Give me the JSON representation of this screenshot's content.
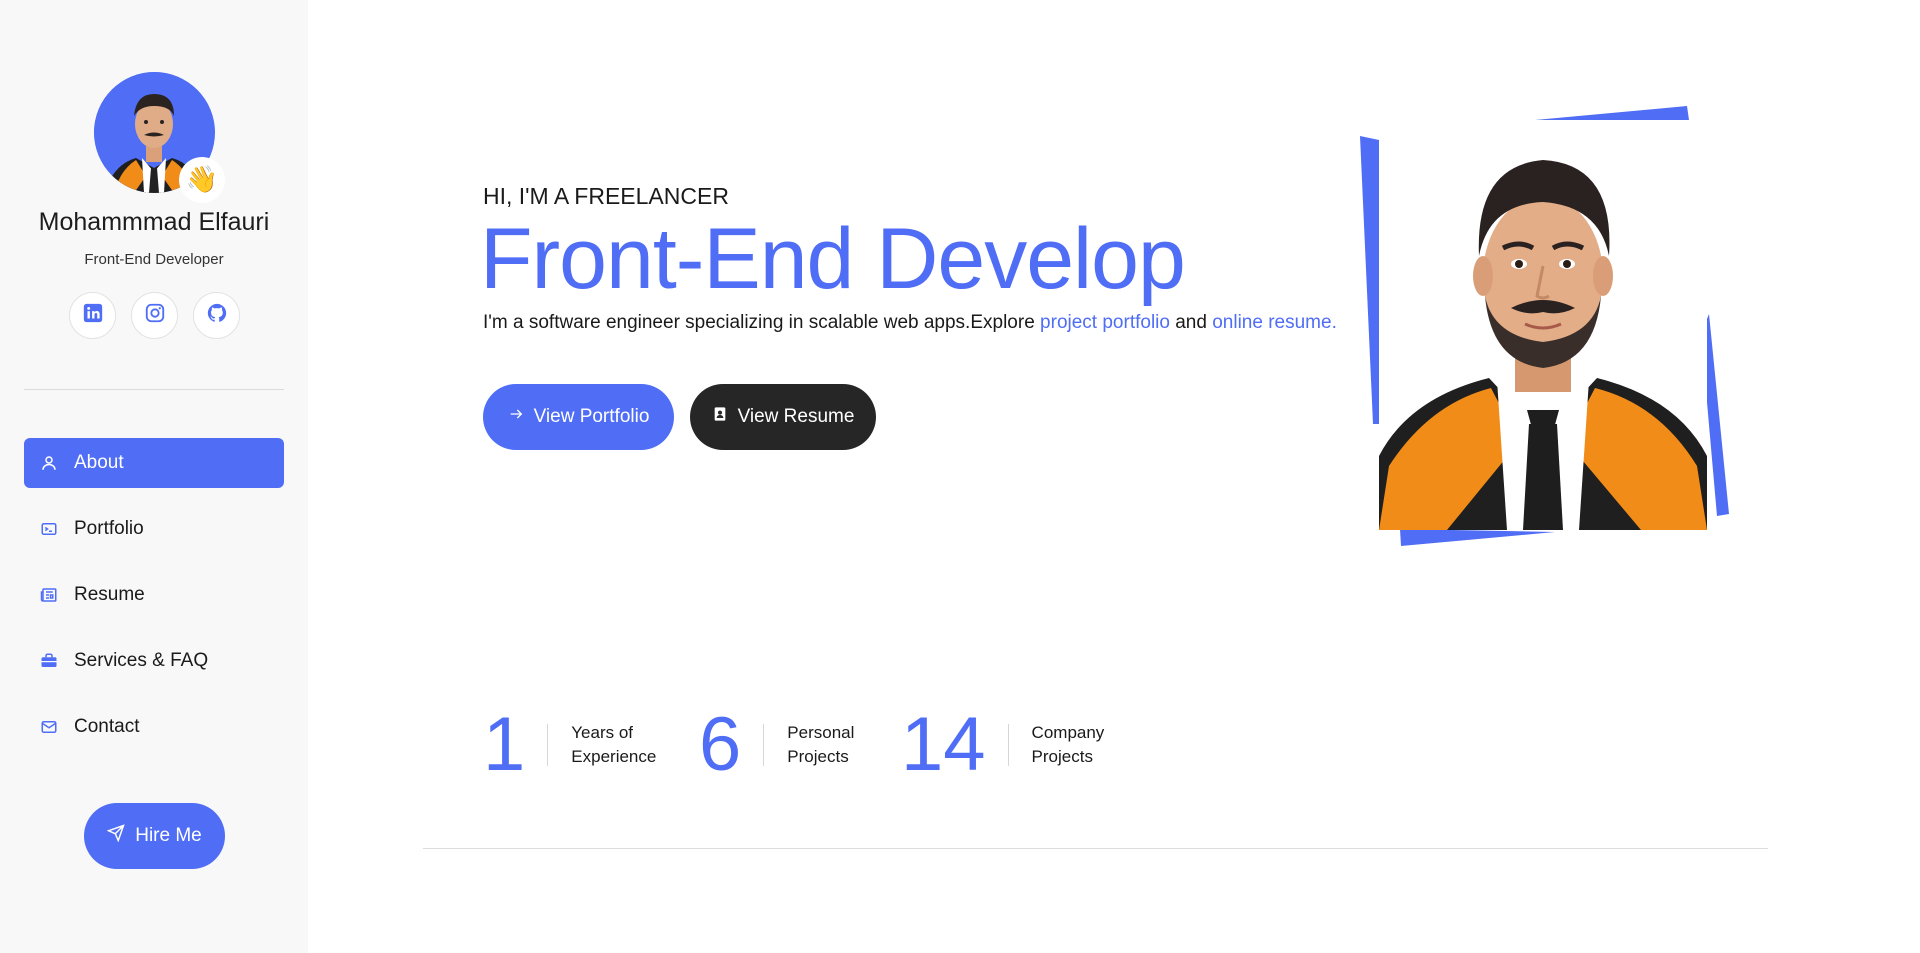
{
  "profile": {
    "name": "Mohammmad Elfauri",
    "role": "Front-End Developer",
    "wave_emoji": "👋"
  },
  "socials": [
    {
      "name": "linkedin",
      "icon": "linkedin-icon"
    },
    {
      "name": "instagram",
      "icon": "instagram-icon"
    },
    {
      "name": "github",
      "icon": "github-icon"
    }
  ],
  "nav": {
    "items": [
      {
        "label": "About",
        "icon": "user-icon",
        "active": true
      },
      {
        "label": "Portfolio",
        "icon": "terminal-icon",
        "active": false
      },
      {
        "label": "Resume",
        "icon": "newspaper-icon",
        "active": false
      },
      {
        "label": "Services & FAQ",
        "icon": "briefcase-icon",
        "active": false
      },
      {
        "label": "Contact",
        "icon": "envelope-icon",
        "active": false
      }
    ]
  },
  "hire": {
    "label": "Hire Me",
    "icon": "send-icon"
  },
  "hero": {
    "intro": "HI, I'M A FREELANCER",
    "headline": "Front-End Develop",
    "desc_prefix": "I'm a software engineer specializing in scalable web apps.Explore ",
    "link_portfolio": "project portfolio",
    "desc_and": " and ",
    "link_resume": "online resume.",
    "btn_portfolio": "View Portfolio",
    "btn_resume": "View Resume"
  },
  "stats": [
    {
      "value": "1",
      "label_line1": "Years of",
      "label_line2": "Experience"
    },
    {
      "value": "6",
      "label_line1": "Personal",
      "label_line2": "Projects"
    },
    {
      "value": "14",
      "label_line1": "Company",
      "label_line2": "Projects"
    }
  ],
  "colors": {
    "accent": "#4f6df5",
    "dark_button": "#262626",
    "sidebar_bg": "#f8f8f8",
    "gown_orange": "#f28c18"
  }
}
